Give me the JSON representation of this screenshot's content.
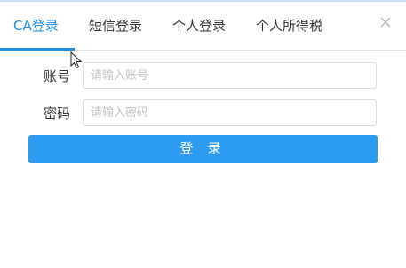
{
  "tabs": [
    {
      "label": "CA登录",
      "active": true
    },
    {
      "label": "短信登录",
      "active": false
    },
    {
      "label": "个人登录",
      "active": false
    },
    {
      "label": "个人所得税",
      "active": false
    }
  ],
  "form": {
    "account_label": "账号",
    "account_placeholder": "请输入账号",
    "account_value": "",
    "password_label": "密码",
    "password_placeholder": "请输入密码",
    "password_value": "",
    "submit_label": "登 录"
  },
  "colors": {
    "accent": "#1e8fe0",
    "button": "#2d9cf0"
  },
  "icons": {
    "close": "close-icon",
    "cursor": "mouse-pointer-icon"
  }
}
